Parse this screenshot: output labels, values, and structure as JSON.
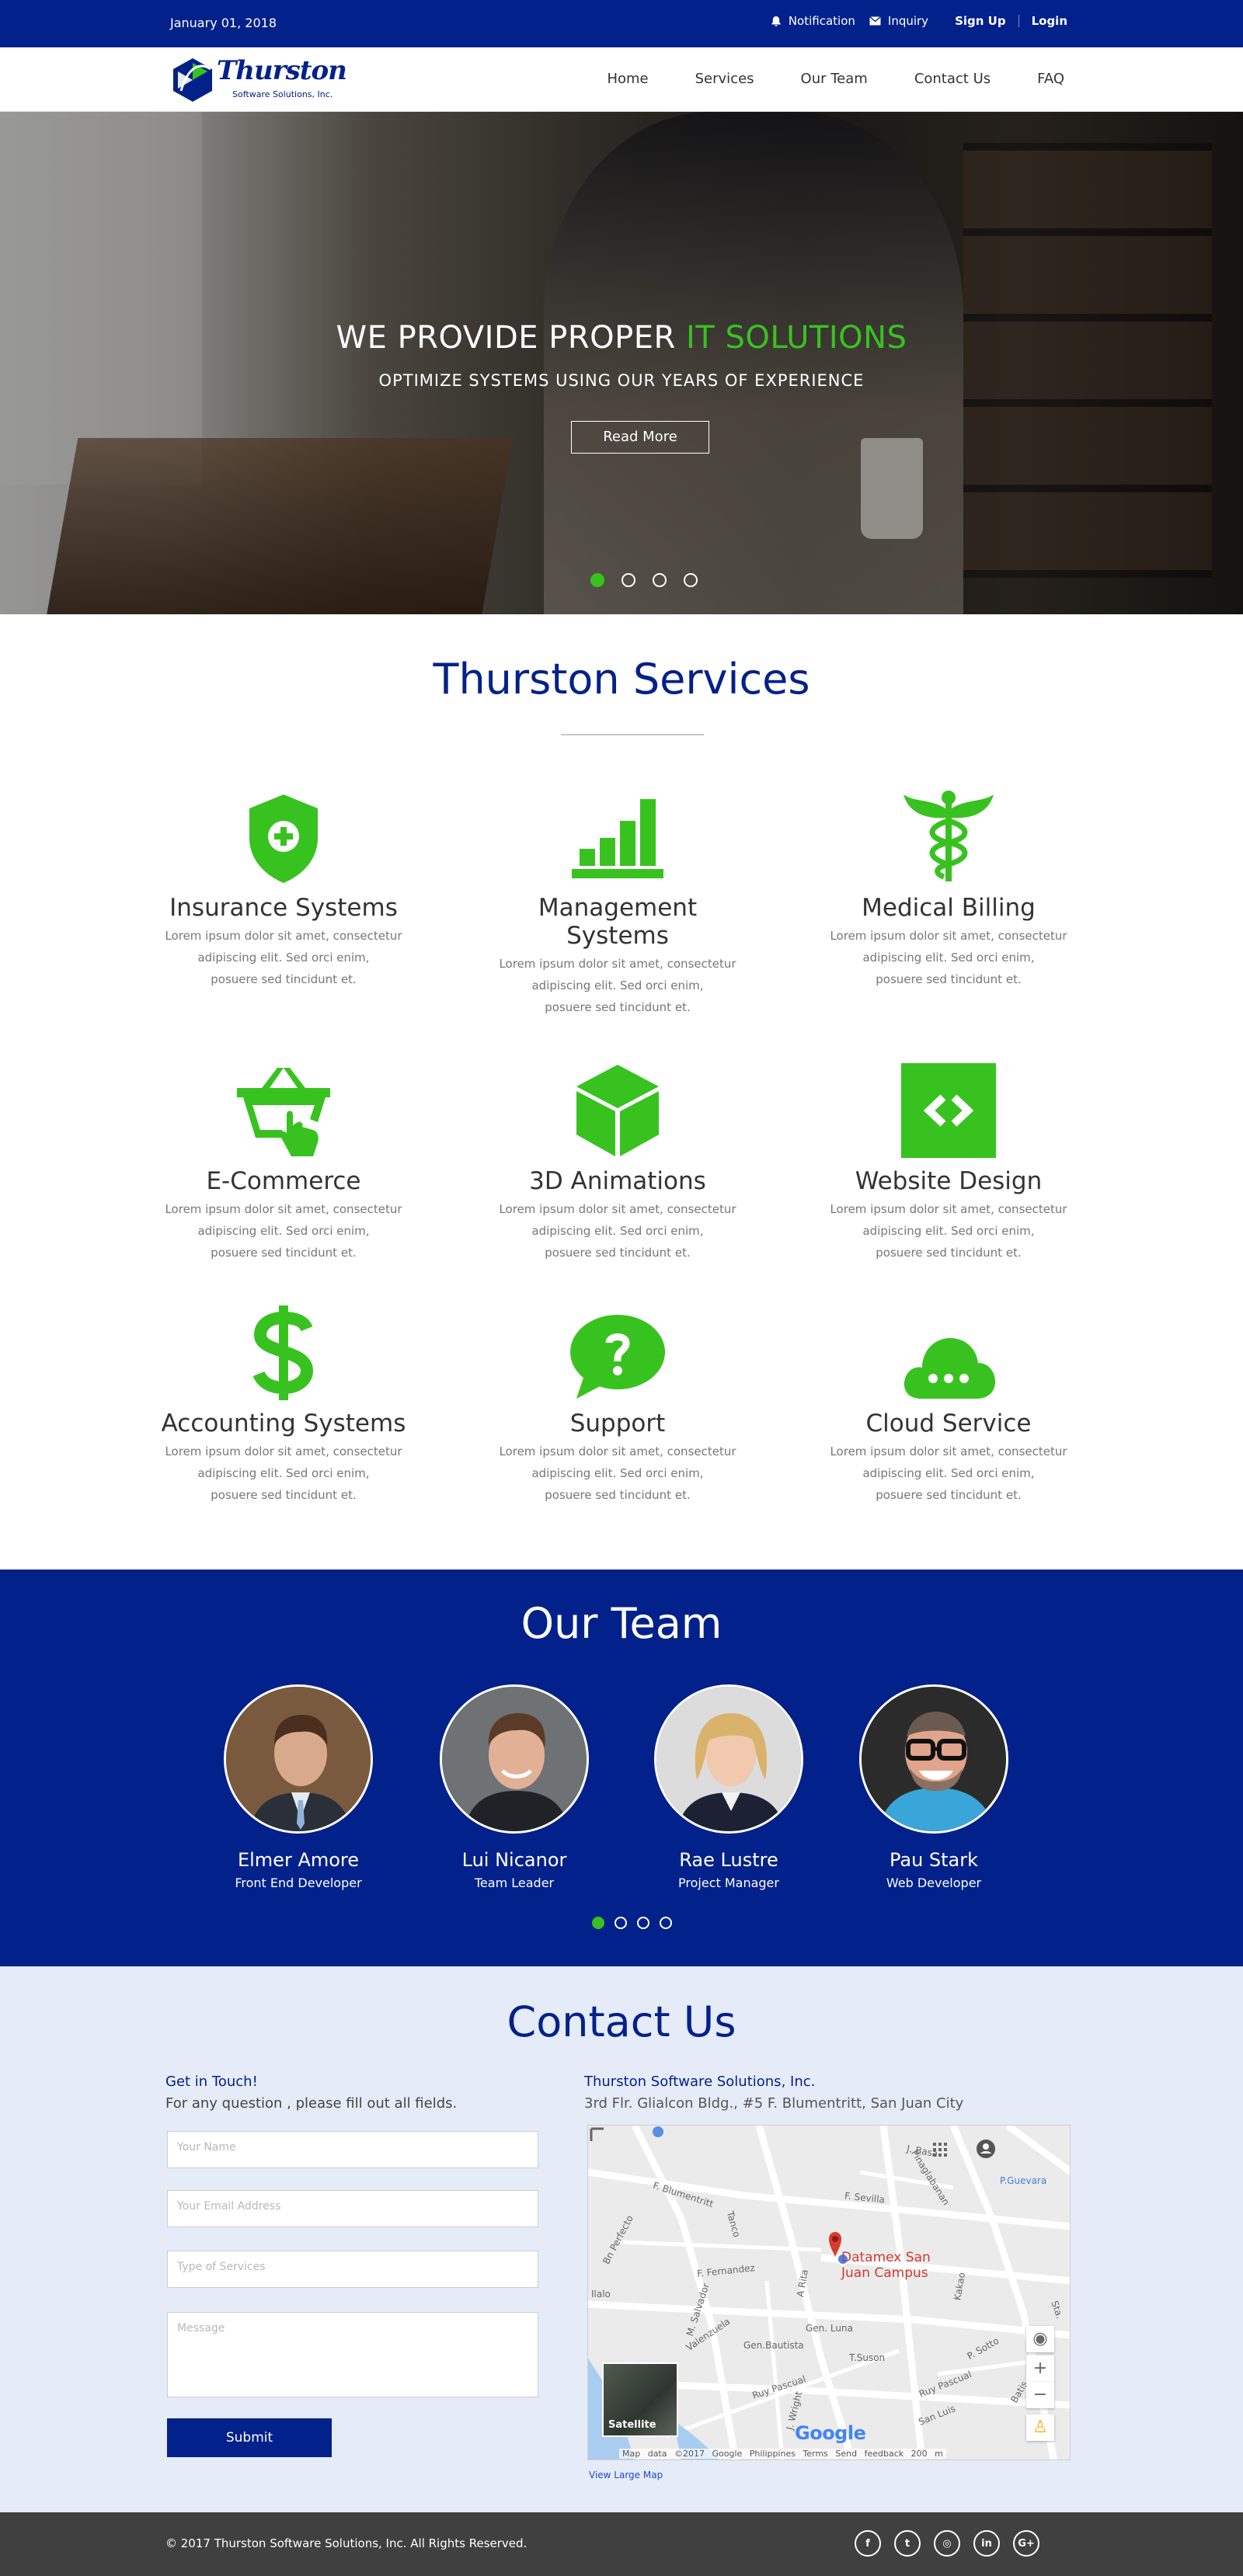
{
  "topbar": {
    "date": "January 01, 2018",
    "notification": "Notification",
    "inquiry": "Inquiry",
    "signup": "Sign Up",
    "login": "Login"
  },
  "brand": {
    "name": "Thurston",
    "tagline": "Software Solutions, Inc."
  },
  "nav": [
    "Home",
    "Services",
    "Our Team",
    "Contact Us",
    "FAQ"
  ],
  "hero": {
    "headline_main": "WE PROVIDE PROPER ",
    "headline_accent": "IT SOLUTIONS",
    "subheadline": "OPTIMIZE SYSTEMS USING OUR YEARS OF EXPERIENCE",
    "button": "Read More",
    "slides": 4,
    "active_slide": 1
  },
  "services": {
    "title": "Thurston Services",
    "items": [
      {
        "title": "Insurance Systems",
        "icon": "shield-plus-icon",
        "desc": [
          "Lorem ipsum dolor sit amet, consectetur",
          "adipiscing elit. Sed orci enim,",
          "posuere sed tincidunt et."
        ]
      },
      {
        "title": "Management Systems",
        "icon": "bar-chart-icon",
        "desc": [
          "Lorem ipsum dolor sit amet, consectetur",
          "adipiscing elit. Sed orci enim,",
          "posuere sed tincidunt et."
        ]
      },
      {
        "title": "Medical Billing",
        "icon": "caduceus-icon",
        "desc": [
          "Lorem ipsum dolor sit amet, consectetur",
          "adipiscing elit. Sed orci enim,",
          "posuere sed tincidunt et."
        ]
      },
      {
        "title": "E-Commerce",
        "icon": "shopping-basket-icon",
        "desc": [
          "Lorem ipsum dolor sit amet, consectetur",
          "adipiscing elit. Sed orci enim,",
          "posuere sed tincidunt et."
        ]
      },
      {
        "title": "3D Animations",
        "icon": "cube-icon",
        "desc": [
          "Lorem ipsum dolor sit amet, consectetur",
          "adipiscing elit. Sed orci enim,",
          "posuere sed tincidunt et."
        ]
      },
      {
        "title": "Website Design",
        "icon": "code-icon",
        "desc": [
          "Lorem ipsum dolor sit amet, consectetur",
          "adipiscing elit. Sed orci enim,",
          "posuere sed tincidunt et."
        ]
      },
      {
        "title": "Accounting Systems",
        "icon": "dollar-icon",
        "desc": [
          "Lorem ipsum dolor sit amet, consectetur",
          "adipiscing elit. Sed orci enim,",
          "posuere sed tincidunt et."
        ]
      },
      {
        "title": "Support",
        "icon": "question-bubble-icon",
        "desc": [
          "Lorem ipsum dolor sit amet, consectetur",
          "adipiscing elit. Sed orci enim,",
          "posuere sed tincidunt et."
        ]
      },
      {
        "title": "Cloud Service",
        "icon": "cloud-icon",
        "desc": [
          "Lorem ipsum dolor sit amet, consectetur",
          "adipiscing elit. Sed orci enim,",
          "posuere sed tincidunt et."
        ]
      }
    ]
  },
  "team": {
    "title": "Our Team",
    "members": [
      {
        "name": "Elmer Amore",
        "role": "Front End Developer"
      },
      {
        "name": "Lui Nicanor",
        "role": "Team Leader"
      },
      {
        "name": "Rae Lustre",
        "role": "Project Manager"
      },
      {
        "name": "Pau Stark",
        "role": "Web Developer"
      }
    ],
    "slides": 4,
    "active_slide": 1
  },
  "contact": {
    "title": "Contact Us",
    "left_title": "Get in Touch!",
    "left_sub": "For any question , please fill out all fields.",
    "placeholders": {
      "name": "Your Name",
      "email": "Your Email Address",
      "service": "Type of Services",
      "message": "Message"
    },
    "submit": "Submit",
    "company": "Thurston Software Solutions, Inc.",
    "address": "3rd Flr. Glialcon Bldg., #5 F. Blumentritt, San Juan City",
    "map": {
      "pin_label_1": "Datamex San",
      "pin_label_2": "Juan Campus",
      "streets": [
        "F. Blumentritt",
        "J. Basa",
        "F. Sevilla",
        "Pinaglabanan",
        "P.Guevara",
        "F. Fernandez",
        "Tanco",
        "Bn Perfecto",
        "Ilalo",
        "M. Salvador",
        "Valenzuela",
        "Gen.Bautista",
        "Ruy Pascual",
        "A Rita",
        "Gen. Luna",
        "T.Suson",
        "San Luis",
        "Batis",
        "Kakao",
        "P. Sotto",
        "Ruy Pascual",
        "Sta."
      ],
      "satellite": "Satellite",
      "google": "Google",
      "attribution": "Map data ©2017 Google   Philippines   Terms   Send feedback   200 m",
      "view_large": "View Large Map"
    }
  },
  "footer": {
    "copyright": "© 2017 Thurston Software Solutions, Inc.  All Rights Reserved.",
    "social": [
      {
        "icon": "facebook-icon",
        "glyph": "f"
      },
      {
        "icon": "twitter-icon",
        "glyph": "t"
      },
      {
        "icon": "instagram-icon",
        "glyph": "◎"
      },
      {
        "icon": "linkedin-icon",
        "glyph": "in"
      },
      {
        "icon": "googleplus-icon",
        "glyph": "G+"
      }
    ]
  },
  "colors": {
    "primary": "#03218a",
    "accent": "#38c220",
    "contact_bg": "#e6ebf8",
    "footer_bg": "#404040"
  }
}
